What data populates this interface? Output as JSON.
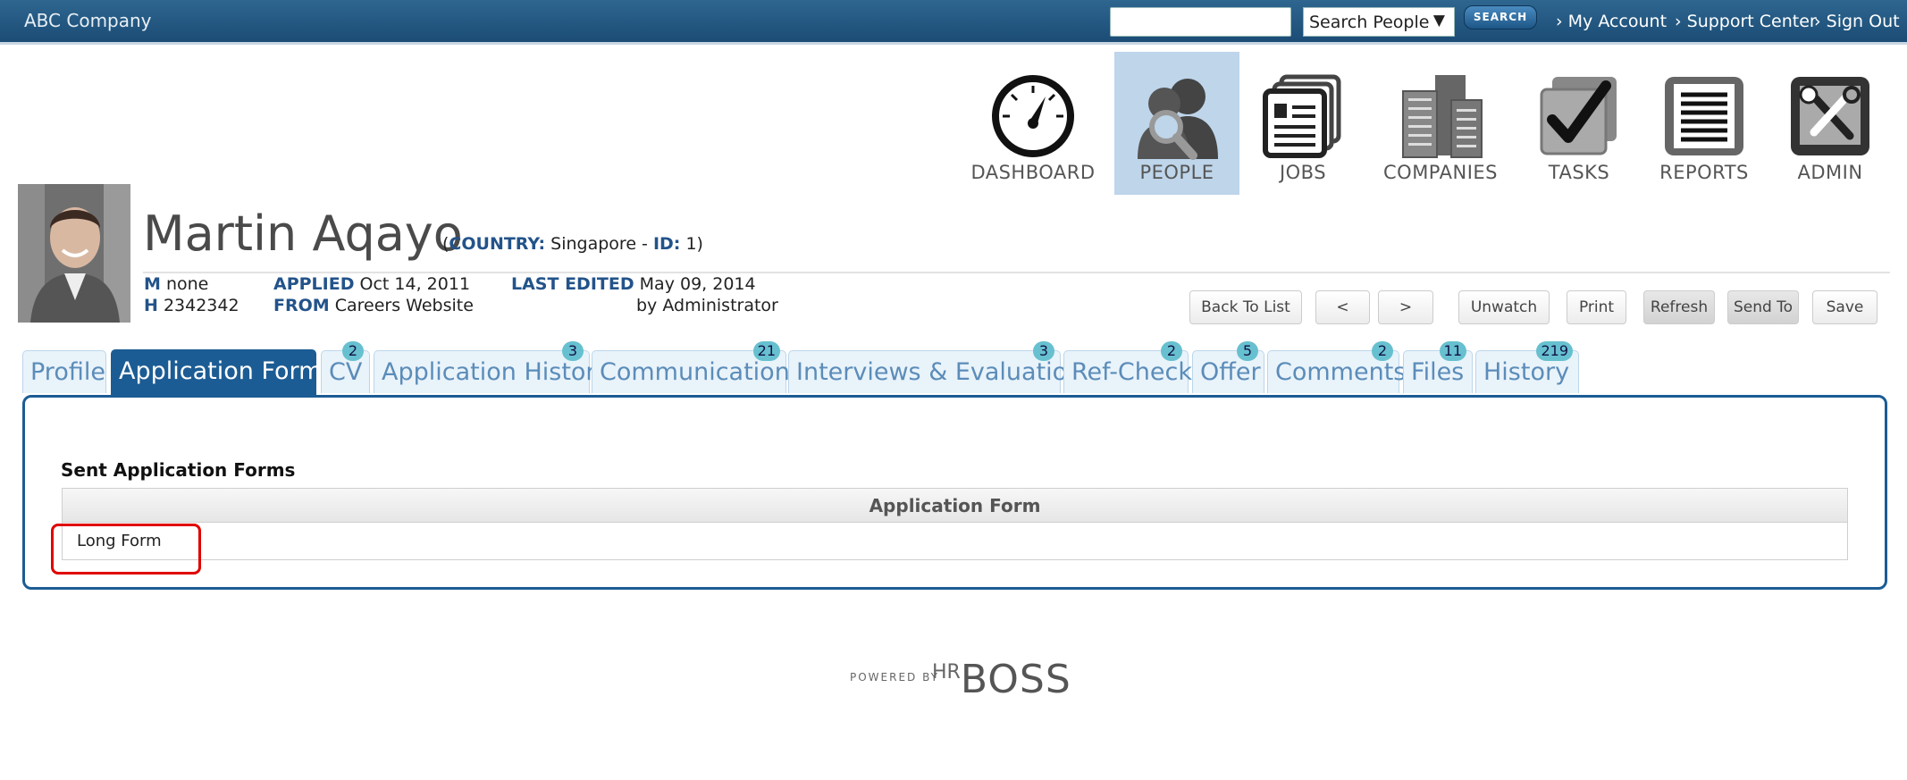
{
  "topbar": {
    "company": "ABC Company",
    "search_value": "",
    "search_scope": "Search People",
    "search_button": "SEARCH",
    "links": [
      "My Account",
      "Support Center",
      "Sign Out"
    ]
  },
  "modules": [
    {
      "label": "DASHBOARD",
      "icon": "dashboard-gauge-icon",
      "active": false
    },
    {
      "label": "PEOPLE",
      "icon": "people-search-icon",
      "active": true
    },
    {
      "label": "JOBS",
      "icon": "jobs-documents-icon",
      "active": false
    },
    {
      "label": "COMPANIES",
      "icon": "companies-buildings-icon",
      "active": false
    },
    {
      "label": "TASKS",
      "icon": "tasks-checkmark-icon",
      "active": false
    },
    {
      "label": "REPORTS",
      "icon": "reports-lines-icon",
      "active": false
    },
    {
      "label": "ADMIN",
      "icon": "admin-tools-icon",
      "active": false
    }
  ],
  "candidate": {
    "name": "Martin Aqayo",
    "country_label": "COUNTRY:",
    "country": "Singapore",
    "id_label": "ID:",
    "id": "1",
    "mobile_label": "M",
    "mobile": "none",
    "home_label": "H",
    "home": "2342342",
    "applied_label": "APPLIED",
    "applied": "Oct 14, 2011",
    "from_label": "FROM",
    "from": "Careers Website",
    "last_edited_label": "LAST EDITED",
    "last_edited": "May 09, 2014",
    "edited_by": "by Administrator"
  },
  "actions": [
    "Back To List",
    "<",
    ">",
    "Unwatch",
    "Print",
    "Refresh",
    "Send To",
    "Save"
  ],
  "tabs": [
    {
      "label": "Profile",
      "badge": ""
    },
    {
      "label": "Application Forms",
      "badge": ""
    },
    {
      "label": "CV",
      "badge": "2"
    },
    {
      "label": "Application History",
      "badge": "3"
    },
    {
      "label": "Communication",
      "badge": "21"
    },
    {
      "label": "Interviews & Evaluations",
      "badge": "3"
    },
    {
      "label": "Ref-Check",
      "badge": "2"
    },
    {
      "label": "Offer",
      "badge": "5"
    },
    {
      "label": "Comments",
      "badge": "2"
    },
    {
      "label": "Files",
      "badge": "11"
    },
    {
      "label": "History",
      "badge": "219"
    }
  ],
  "forms": {
    "title": "Sent Application Forms",
    "column_header": "Application Form",
    "rows": [
      "Long Form"
    ]
  },
  "footer": {
    "powered_by": "POWERED BY",
    "brand_hr": "HR",
    "brand_boss": "BOSS"
  },
  "colors": {
    "topbar": "#1b4c75",
    "accent": "#1c5c94",
    "active_module": "#bed5ea",
    "badge": "#67c0cf",
    "highlight": "#e00000"
  }
}
